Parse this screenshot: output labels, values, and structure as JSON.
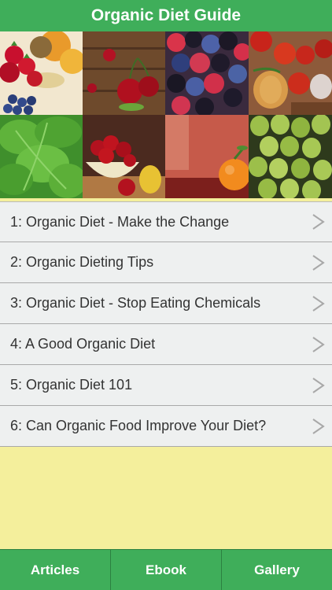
{
  "header": {
    "title": "Organic Diet Guide"
  },
  "gallery_images": [
    "strawberries-kiwi-blueberries-image",
    "cherries-on-wood-image",
    "mixed-berries-image",
    "tomatoes-onion-garlic-image",
    "lettuce-leaves-image",
    "cherries-bowl-image",
    "orange-on-table-image",
    "green-pears-image"
  ],
  "articles": [
    {
      "label": "1: Organic Diet - Make the Change"
    },
    {
      "label": "2: Organic Dieting Tips"
    },
    {
      "label": "3: Organic Diet - Stop Eating Chemicals"
    },
    {
      "label": "4: A Good Organic Diet"
    },
    {
      "label": "5: Organic Diet 101"
    },
    {
      "label": "6: Can Organic Food Improve Your Diet?"
    }
  ],
  "tabs": [
    {
      "label": "Articles"
    },
    {
      "label": "Ebook"
    },
    {
      "label": "Gallery"
    }
  ],
  "colors": {
    "header_green": "#3fae5a",
    "background_yellow": "#f4ef9c",
    "list_item_bg": "#eef0f0"
  }
}
